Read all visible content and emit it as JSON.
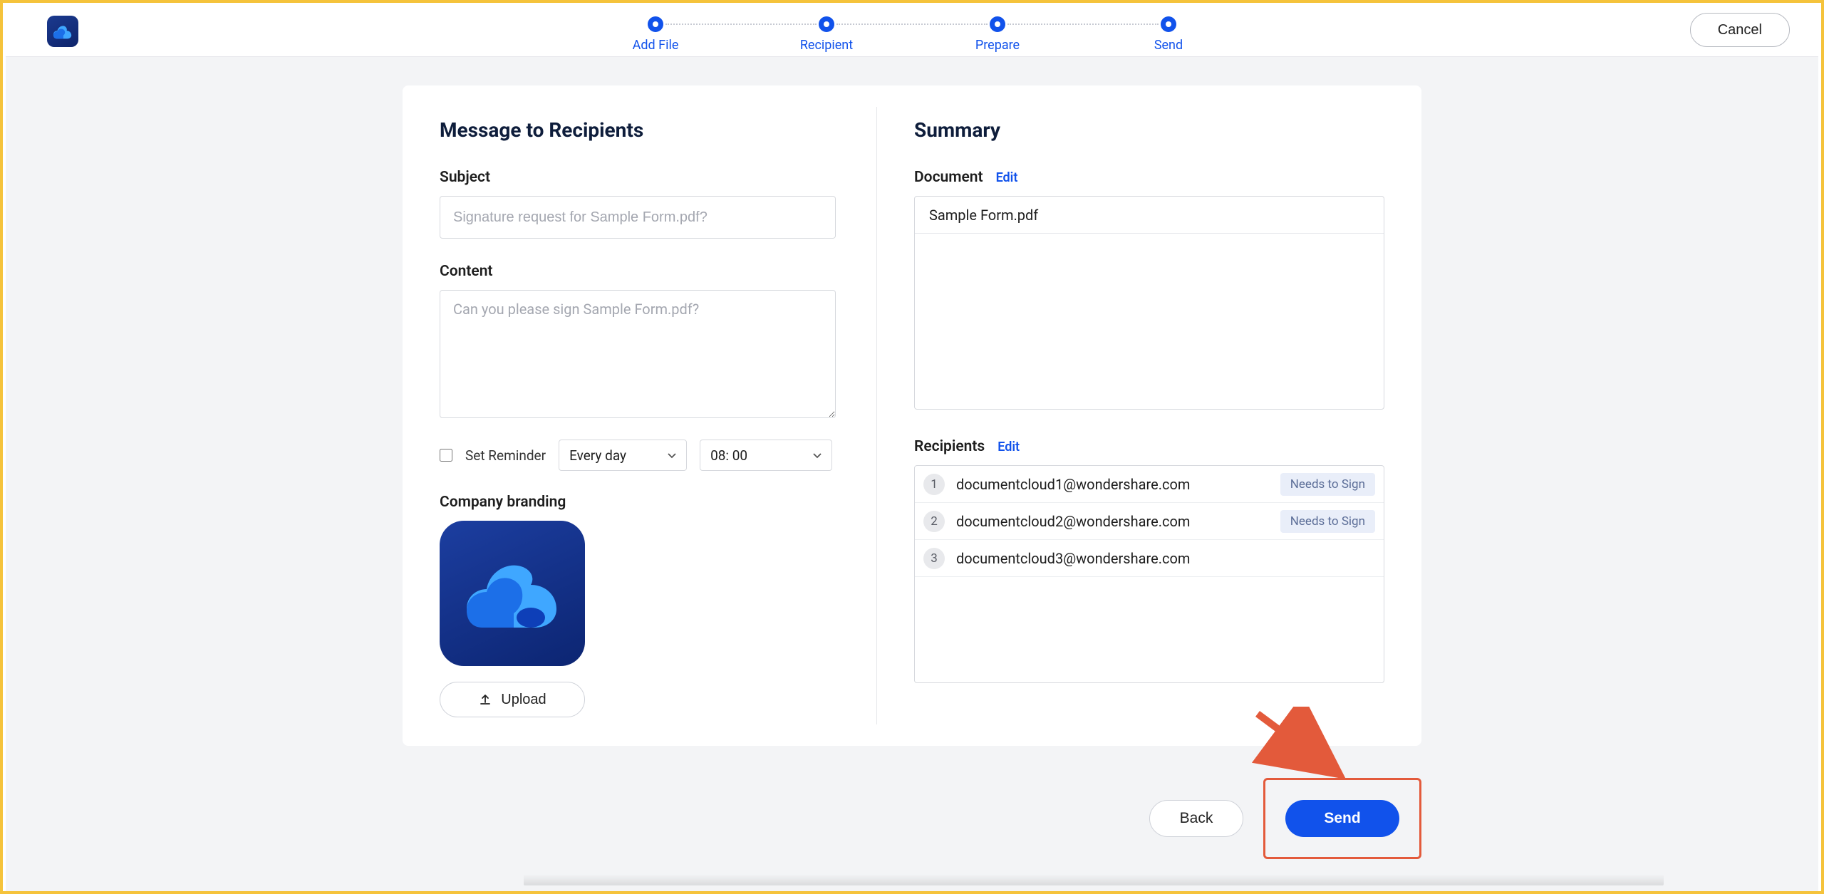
{
  "header": {
    "steps": [
      "Add File",
      "Recipient",
      "Prepare",
      "Send"
    ],
    "cancel": "Cancel"
  },
  "left": {
    "title": "Message to Recipients",
    "subject_label": "Subject",
    "subject_placeholder": "Signature request for Sample Form.pdf?",
    "content_label": "Content",
    "content_placeholder": "Can you please sign Sample Form.pdf?",
    "reminder_label": "Set Reminder",
    "reminder_freq": "Every day",
    "reminder_time": "08: 00",
    "branding_label": "Company branding",
    "upload_label": "Upload"
  },
  "right": {
    "title": "Summary",
    "document_label": "Document",
    "edit_label": "Edit",
    "document_name": "Sample Form.pdf",
    "recipients_label": "Recipients",
    "recipients": [
      {
        "num": "1",
        "email": "documentcloud1@wondershare.com",
        "status": "Needs to Sign"
      },
      {
        "num": "2",
        "email": "documentcloud2@wondershare.com",
        "status": "Needs to Sign"
      },
      {
        "num": "3",
        "email": "documentcloud3@wondershare.com",
        "status": ""
      }
    ]
  },
  "footer": {
    "back": "Back",
    "send": "Send"
  }
}
